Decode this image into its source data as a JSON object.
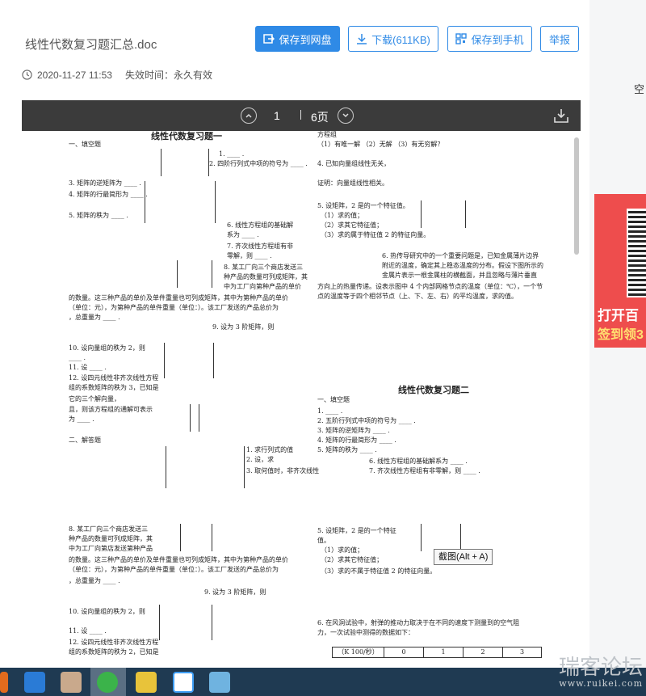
{
  "header": {
    "file_name": "线性代数复习题汇总.doc",
    "save_cloud": "保存到网盘",
    "download": "下载(611KB)",
    "save_phone": "保存到手机",
    "report": "举报",
    "timestamp": "2020-11-27 11:53",
    "expiry": "失效时间：永久有效"
  },
  "viewer": {
    "current_page": "1",
    "total_pages": "6页"
  },
  "doc": {
    "title1": "线性代数复习题一",
    "title2": "线性代数复习题二",
    "left1": [
      "一、填空题",
      "1. ____ .",
      "2. 四阶行列式中项的符号为 ____ .",
      "3. 矩阵的逆矩阵为 ____ .",
      "4. 矩阵的行最简形为 ____ .",
      "5. 矩阵的秩为 ____ .",
      "6. 线性方程组的基础解",
      "系为 ____ .",
      "7. 齐次线性方程组有非",
      "零解，则 ____ .",
      "8. 某工厂向三个商店发送三",
      "种产品的数量可列成矩阵，其",
      "中为工厂向第种产品的单价",
      "的数量。这三种产品的单价及单件重量也可列成矩阵，其中为第种产品的单价",
      "（单位：元），为第种产品的单件重量（单位：）。该工厂发送的产品总价为",
      "，总重量为 ____ .",
      "9. 设为 3 阶矩阵，则",
      "10. 设向量组的秩为 2，则",
      "____ .",
      "11. 设 ____ .",
      "12. 设四元线性非齐次线性方程",
      "组的系数矩阵的秩为 3，已知是",
      "它的三个解向量，",
      "且，则该方程组的通解可表示",
      "为 ____ .",
      "二、解答题",
      "1. 求行列式的值",
      "2. 设，求",
      "3. 取何值时，非齐次线性"
    ],
    "right1": [
      "方程组",
      "（1）有唯一解  （2）无解  （3）有无穷解？",
      "4. 已知向量组线性无关，",
      "证明：向量组线性相关。",
      "5. 设矩阵，2 是的一个特征值。",
      "（1）求的值；",
      "（2）求其它特征值；",
      "（3）求的属于特征值 2 的特征向量。",
      "6. 热传导研究中的一个重要问题是，已知金属薄片边界",
      "附近的温度，确定其上稳态温度的分布。假设下图所示的",
      "金属片表示一根金属柱的横截面，并且忽略与薄片垂直",
      "方向上的热量传递。设表示图中 4 个内部网格节点的温度（单位：℃），一个节",
      "点的温度等于四个相邻节点（上、下、左、右）的平均温度，求的值。"
    ],
    "right2": [
      "一、填空题",
      "1. ____ .",
      "2. 五阶行列式中项的符号为 ____ .",
      "3. 矩阵的逆矩阵为 ____ .",
      "4. 矩阵的行最简形为 ____ .",
      "5. 矩阵的秩为 ____ .",
      "6. 线性方程组的基础解系为 ____ .",
      "7. 齐次线性方程组有非零解，则 ____ ."
    ],
    "left2": [
      "8. 某工厂向三个商店发送三",
      "种产品的数量可列成矩阵，其",
      "中为工厂向第店发送第种产品",
      "的数量。这三种产品的单价及单件重量也可列成矩阵，其中为第种产品的单价",
      "（单位：元），为第种产品的单件重量（单位：）。该工厂发送的产品总价为",
      "，总重量为 ____ .",
      "9. 设为 3 阶矩阵，则",
      "10. 设向量组的秩为 2，则",
      "11. 设 ____ .",
      "12. 设四元线性非齐次线性方程",
      "组的系数矩阵的秩为 2，已知是"
    ],
    "right3": [
      "5. 设矩阵，2 是的一个特征",
      "值。",
      "（1）求的值；",
      "（2）求其它特征值；",
      "（3）求的不属于特征值 2 的特征向量。",
      "6. 在风洞试验中，射弹的推动力取决于在不同的速度下测量到的空气阻",
      "力，一次试验中测得的数据如下："
    ],
    "table_header": [
      "（K 100/秒）",
      "0",
      "1",
      "2",
      "3"
    ]
  },
  "tooltip": "截图(Alt + A)",
  "side": {
    "side_char": "空",
    "promo_line1": "打开百",
    "promo_line2": "签到领3"
  },
  "watermark": {
    "cn": "瑞客论坛",
    "url": "www.ruikei.com"
  }
}
